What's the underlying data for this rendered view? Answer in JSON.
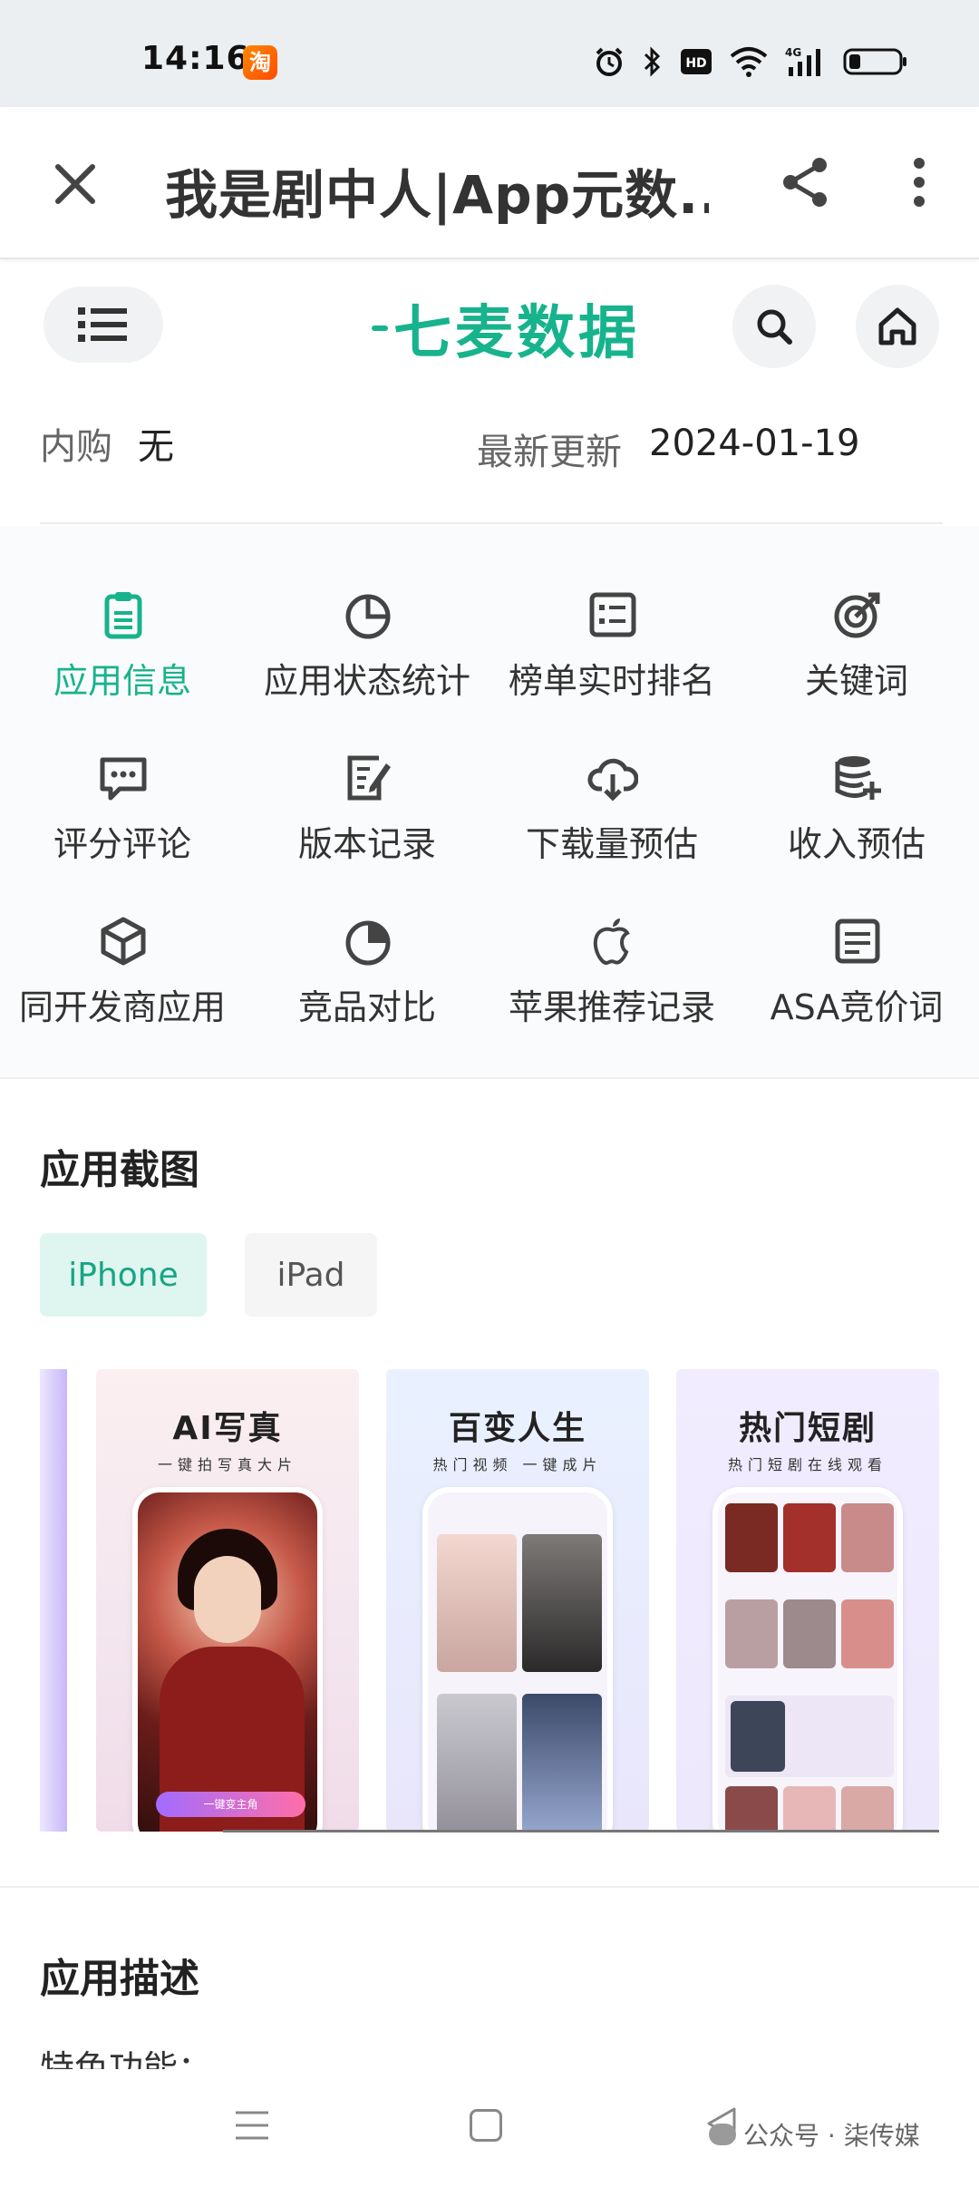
{
  "status_bar": {
    "time": "14:16",
    "app_badge": "淘"
  },
  "top_bar": {
    "title": "我是剧中人|App元数..."
  },
  "site_header": {
    "logo_text": "七麦数据"
  },
  "info": {
    "iap_label": "内购",
    "iap_value": "无",
    "updated_label": "最新更新",
    "updated_value": "2024-01-19"
  },
  "features": [
    {
      "label": "应用信息",
      "icon": "clipboard-icon",
      "active": true
    },
    {
      "label": "应用状态统计",
      "icon": "pie-chart-icon"
    },
    {
      "label": "榜单实时排名",
      "icon": "list-icon"
    },
    {
      "label": "关键词",
      "icon": "target-icon"
    },
    {
      "label": "评分评论",
      "icon": "comment-icon"
    },
    {
      "label": "版本记录",
      "icon": "edit-doc-icon"
    },
    {
      "label": "下载量预估",
      "icon": "cloud-download-icon"
    },
    {
      "label": "收入预估",
      "icon": "database-add-icon"
    },
    {
      "label": "同开发商应用",
      "icon": "cube-icon"
    },
    {
      "label": "竞品对比",
      "icon": "pie-icon"
    },
    {
      "label": "苹果推荐记录",
      "icon": "apple-icon"
    },
    {
      "label": "ASA竞价词",
      "icon": "document-icon"
    }
  ],
  "screenshots_section": {
    "title": "应用截图",
    "tabs": [
      "iPhone",
      "iPad"
    ],
    "active_tab": "iPhone",
    "shots": [
      {
        "title": "AI写真",
        "subtitle": "一键拍写真大片",
        "button": "一键变主角"
      },
      {
        "title": "百变人生",
        "subtitle": "热门视频 一键成片"
      },
      {
        "title": "热门短剧",
        "subtitle": "热门短剧在线观看"
      }
    ]
  },
  "description_section": {
    "title": "应用描述",
    "first_line": "特色功能："
  },
  "watermark": {
    "text": "公众号 · 柒传媒"
  },
  "colors": {
    "accent": "#17b38c",
    "active_tab_bg": "#dff5ef"
  }
}
